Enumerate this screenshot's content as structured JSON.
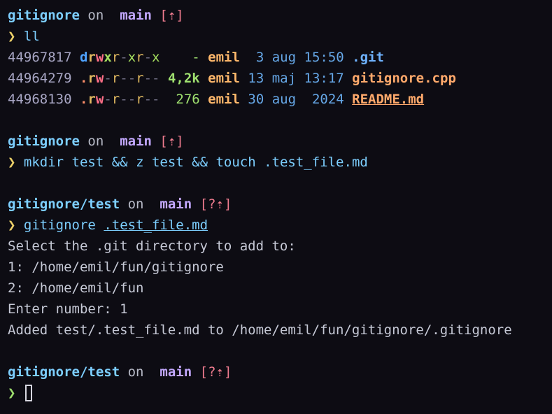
{
  "blocks": [
    {
      "prompt": {
        "dir": "gitignore",
        "on": "on",
        "branch_icon": "",
        "branch": "main",
        "status": "[⇡]"
      },
      "symbol": "❯",
      "command": "ll"
    },
    {
      "prompt": {
        "dir": "gitignore",
        "on": "on",
        "branch_icon": "",
        "branch": "main",
        "status": "[⇡]"
      },
      "symbol": "❯",
      "command_parts": [
        "mkdir",
        " test && ",
        "z",
        " test && ",
        "touch",
        " .test_file.md"
      ]
    },
    {
      "prompt": {
        "dir": "gitignore/test",
        "on": "on",
        "branch_icon": "",
        "branch": "main",
        "status": "[?⇡]"
      },
      "symbol": "❯",
      "command": "gitignore",
      "command_arg": ".test_file.md"
    },
    {
      "prompt": {
        "dir": "gitignore/test",
        "on": "on",
        "branch_icon": "",
        "branch": "main",
        "status": "[?⇡]"
      },
      "symbol": "❯"
    }
  ],
  "listing": [
    {
      "inode": "44967817",
      "perm": [
        "d",
        "r",
        "w",
        "x",
        "r",
        "-",
        "x",
        "r",
        "-",
        "x"
      ],
      "size": "-",
      "user": "emil",
      "day": "3",
      "month": "aug",
      "time": "15:50",
      "name": ".git",
      "kind": "dir"
    },
    {
      "inode": "44964279",
      "perm": [
        ".",
        "r",
        "w",
        "-",
        "r",
        "-",
        "-",
        "r",
        "-",
        "-"
      ],
      "size": "4,2k",
      "user": "emil",
      "day": "13",
      "month": "maj",
      "time": "13:17",
      "name": "gitignore.cpp",
      "kind": "file"
    },
    {
      "inode": "44968130",
      "perm": [
        ".",
        "r",
        "w",
        "-",
        "r",
        "-",
        "-",
        "r",
        "-",
        "-"
      ],
      "size": "276",
      "user": "emil",
      "day": "30",
      "month": "aug",
      "time": "2024",
      "name": "README.md",
      "kind": "readme"
    }
  ],
  "output": [
    "Select the .git directory to add to:",
    "1: /home/emil/fun/gitignore",
    "2: /home/emil/fun",
    "Enter number: 1",
    "Added test/.test_file.md to /home/emil/fun/gitignore/.gitignore"
  ]
}
